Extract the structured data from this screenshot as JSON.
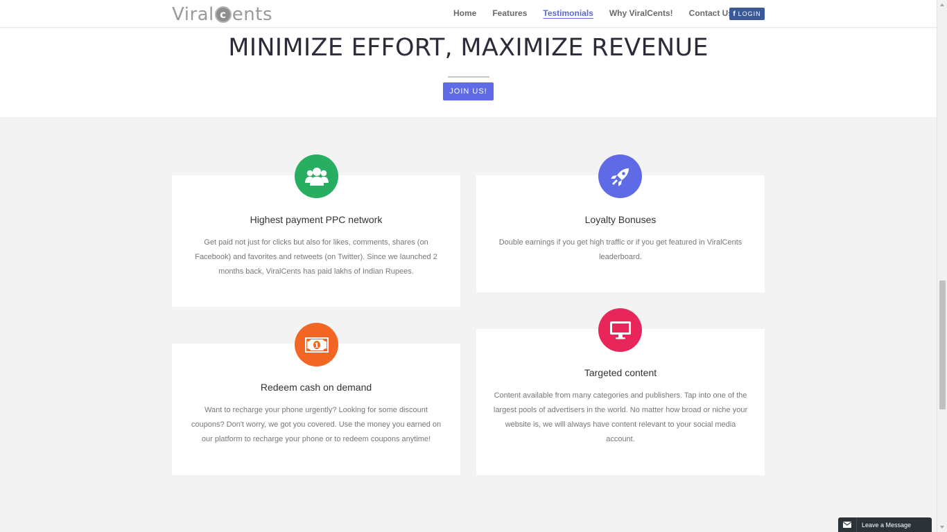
{
  "brand": {
    "name_left": "Viral",
    "name_mark": "c",
    "name_right": "ents"
  },
  "nav": {
    "items": [
      {
        "label": "Home",
        "active": false
      },
      {
        "label": "Features",
        "active": false
      },
      {
        "label": "Testimonials",
        "active": true
      },
      {
        "label": "Why ViralCents!",
        "active": false
      },
      {
        "label": "Contact Us",
        "active": false
      }
    ],
    "login_icon": "f",
    "login_label": "LOGIN"
  },
  "hero": {
    "title": "MINIMIZE EFFORT, MAXIMIZE REVENUE",
    "cta_label": "JOIN US!"
  },
  "features": [
    {
      "icon": "users-icon",
      "color": "#27ae60",
      "title": "Highest payment PPC network",
      "text": "Get paid not just for clicks but also for likes, comments, shares (on Facebook) and favorites and retweets (on Twitter). Since we launched 2 months back, ViralCents has paid lakhs of Indian Rupees."
    },
    {
      "icon": "rocket-icon",
      "color": "#5e6ae6",
      "title": "Loyalty Bonuses",
      "text": "Double earnings if you get high traffic or if you get featured in ViralCents leaderboard."
    },
    {
      "icon": "money-icon",
      "color": "#f26522",
      "title": "Redeem cash on demand",
      "text": "Want to recharge your phone urgently? Looking for some discount coupons? Don't worry, we got you covered. Use the money you earned on our platform to recharge your phone or to redeem coupons anytime!"
    },
    {
      "icon": "desktop-icon",
      "color": "#e8265a",
      "title": "Targeted content",
      "text": "Content available from many categories and publishers. Tap into one of the largest pools of advertisers in the world. No matter how broad or niche your website is, we will always have content relevant to your social media account."
    }
  ],
  "chat_widget": {
    "label": "Leave a Message",
    "icon": "envelope-icon"
  }
}
